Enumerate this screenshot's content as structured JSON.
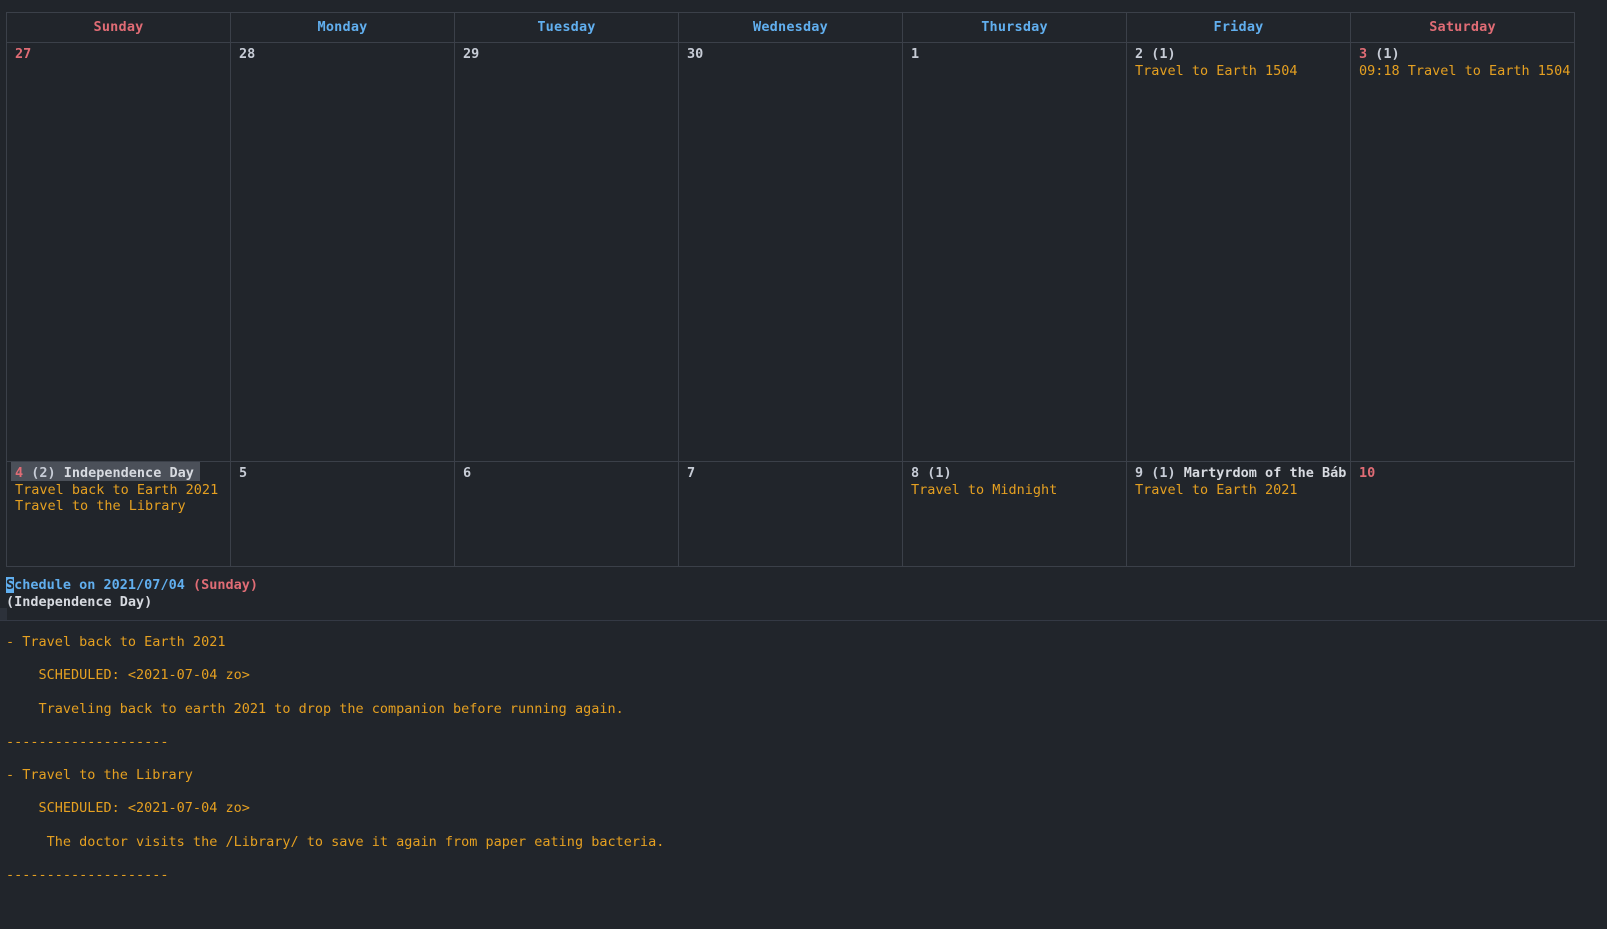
{
  "app": {
    "kind": "emacs-calendar-calfw",
    "colors": {
      "background": "#21252b",
      "grid_border": "#3b4049",
      "weekend_red": "#e06c75",
      "weekday_blue": "#61afef",
      "event_orange": "#e5a021",
      "text": "#c7ccd6",
      "selection": "#4b5059",
      "cursor": "#61afef"
    }
  },
  "calendar": {
    "day_headers": [
      {
        "label": "Sunday",
        "type": "weekend"
      },
      {
        "label": "Monday",
        "type": "weekday"
      },
      {
        "label": "Tuesday",
        "type": "weekday"
      },
      {
        "label": "Wednesday",
        "type": "weekday"
      },
      {
        "label": "Thursday",
        "type": "weekday"
      },
      {
        "label": "Friday",
        "type": "weekday"
      },
      {
        "label": "Saturday",
        "type": "weekend"
      }
    ],
    "weeks": [
      {
        "days": [
          {
            "num": "27",
            "count": "",
            "holiday": "",
            "weekend": true,
            "selected": false,
            "events": []
          },
          {
            "num": "28",
            "count": "",
            "holiday": "",
            "weekend": false,
            "selected": false,
            "events": []
          },
          {
            "num": "29",
            "count": "",
            "holiday": "",
            "weekend": false,
            "selected": false,
            "events": []
          },
          {
            "num": "30",
            "count": "",
            "holiday": "",
            "weekend": false,
            "selected": false,
            "events": []
          },
          {
            "num": "1",
            "count": "",
            "holiday": "",
            "weekend": false,
            "selected": false,
            "events": []
          },
          {
            "num": "2",
            "count": "(1)",
            "holiday": "",
            "weekend": false,
            "selected": false,
            "events": [
              "Travel to Earth 1504"
            ]
          },
          {
            "num": "3",
            "count": "(1)",
            "holiday": "",
            "weekend": true,
            "selected": false,
            "events": [
              "09:18 Travel to Earth 1504"
            ]
          }
        ]
      },
      {
        "days": [
          {
            "num": "4",
            "count": "(2)",
            "holiday": "Independence Day",
            "weekend": true,
            "selected": true,
            "events": [
              "Travel back to Earth 2021",
              "Travel to the Library"
            ]
          },
          {
            "num": "5",
            "count": "",
            "holiday": "",
            "weekend": false,
            "selected": false,
            "events": []
          },
          {
            "num": "6",
            "count": "",
            "holiday": "",
            "weekend": false,
            "selected": false,
            "events": []
          },
          {
            "num": "7",
            "count": "",
            "holiday": "",
            "weekend": false,
            "selected": false,
            "events": []
          },
          {
            "num": "8",
            "count": "(1)",
            "holiday": "",
            "weekend": false,
            "selected": false,
            "events": [
              "Travel to Midnight"
            ]
          },
          {
            "num": "9",
            "count": "(1)",
            "holiday": "Martyrdom of the Báb",
            "weekend": false,
            "selected": false,
            "events": [
              "Travel to Earth 2021"
            ]
          },
          {
            "num": "10",
            "count": "",
            "holiday": "",
            "weekend": true,
            "selected": false,
            "events": []
          }
        ]
      }
    ]
  },
  "schedule": {
    "cursor_char": "S",
    "title_rest": "chedule on 2021/07/04 ",
    "title_dow": "(Sunday)",
    "holiday_line": "(Independence Day)",
    "entries": [
      {
        "heading": "- Travel back to Earth 2021",
        "scheduled": "    SCHEDULED: <2021-07-04 zo>",
        "note": "    Traveling back to earth 2021 to drop the companion before running again.",
        "divider": "--------------------"
      },
      {
        "heading": "- Travel to the Library",
        "scheduled": "    SCHEDULED: <2021-07-04 zo>",
        "note": "     The doctor visits the /Library/ to save it again from paper eating bacteria.",
        "divider": "--------------------"
      }
    ]
  }
}
